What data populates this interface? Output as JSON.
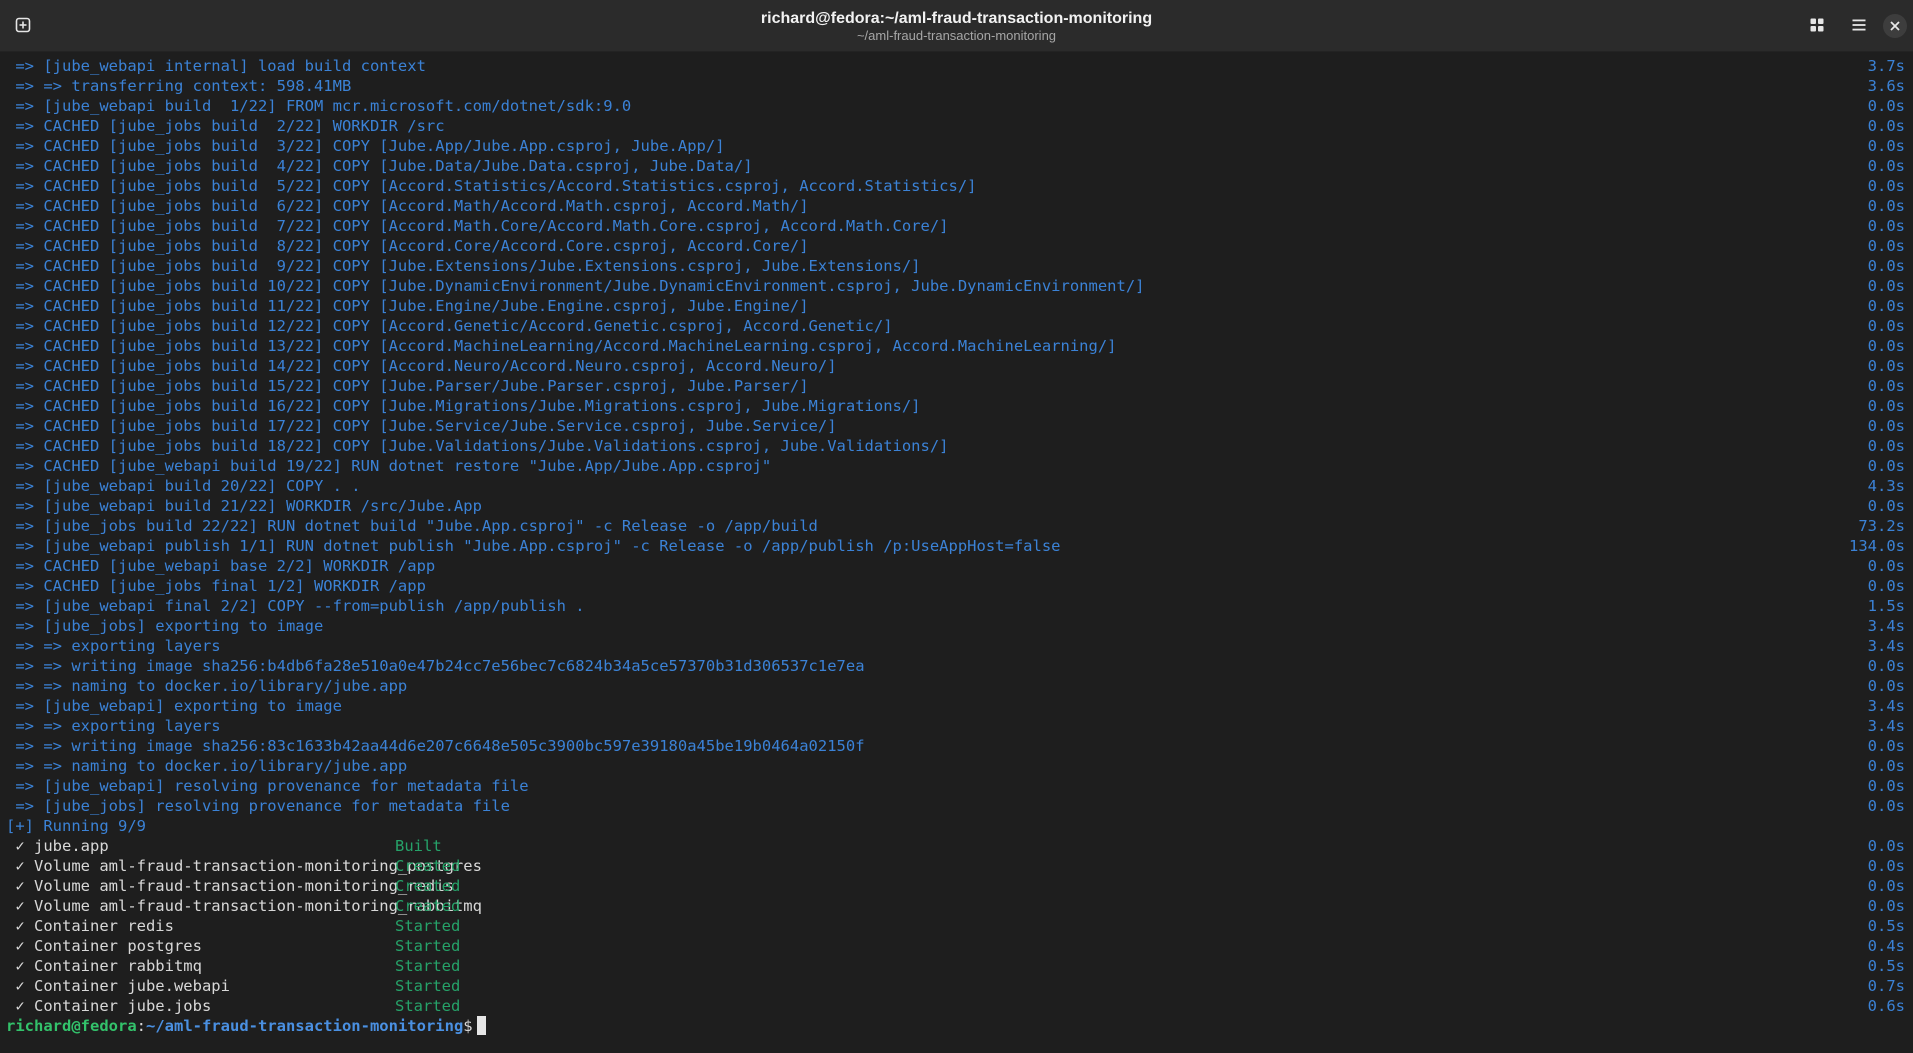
{
  "window": {
    "title": "richard@fedora:~/aml-fraud-transaction-monitoring",
    "subtitle": "~/aml-fraud-transaction-monitoring",
    "icons": {
      "new_tab": "new-tab-icon",
      "view": "grid-view-icon",
      "menu": "hamburger-menu-icon",
      "close": "close-icon"
    }
  },
  "build_log": [
    {
      "text": " => [jube_webapi internal] load build context",
      "time": "3.7s"
    },
    {
      "text": " => => transferring context: 598.41MB",
      "time": "3.6s"
    },
    {
      "text": " => [jube_webapi build  1/22] FROM mcr.microsoft.com/dotnet/sdk:9.0",
      "time": "0.0s"
    },
    {
      "text": " => CACHED [jube_jobs build  2/22] WORKDIR /src",
      "time": "0.0s"
    },
    {
      "text": " => CACHED [jube_jobs build  3/22] COPY [Jube.App/Jube.App.csproj, Jube.App/]",
      "time": "0.0s"
    },
    {
      "text": " => CACHED [jube_jobs build  4/22] COPY [Jube.Data/Jube.Data.csproj, Jube.Data/]",
      "time": "0.0s"
    },
    {
      "text": " => CACHED [jube_jobs build  5/22] COPY [Accord.Statistics/Accord.Statistics.csproj, Accord.Statistics/]",
      "time": "0.0s"
    },
    {
      "text": " => CACHED [jube_jobs build  6/22] COPY [Accord.Math/Accord.Math.csproj, Accord.Math/]",
      "time": "0.0s"
    },
    {
      "text": " => CACHED [jube_jobs build  7/22] COPY [Accord.Math.Core/Accord.Math.Core.csproj, Accord.Math.Core/]",
      "time": "0.0s"
    },
    {
      "text": " => CACHED [jube_jobs build  8/22] COPY [Accord.Core/Accord.Core.csproj, Accord.Core/]",
      "time": "0.0s"
    },
    {
      "text": " => CACHED [jube_jobs build  9/22] COPY [Jube.Extensions/Jube.Extensions.csproj, Jube.Extensions/]",
      "time": "0.0s"
    },
    {
      "text": " => CACHED [jube_jobs build 10/22] COPY [Jube.DynamicEnvironment/Jube.DynamicEnvironment.csproj, Jube.DynamicEnvironment/]",
      "time": "0.0s"
    },
    {
      "text": " => CACHED [jube_jobs build 11/22] COPY [Jube.Engine/Jube.Engine.csproj, Jube.Engine/]",
      "time": "0.0s"
    },
    {
      "text": " => CACHED [jube_jobs build 12/22] COPY [Accord.Genetic/Accord.Genetic.csproj, Accord.Genetic/]",
      "time": "0.0s"
    },
    {
      "text": " => CACHED [jube_jobs build 13/22] COPY [Accord.MachineLearning/Accord.MachineLearning.csproj, Accord.MachineLearning/]",
      "time": "0.0s"
    },
    {
      "text": " => CACHED [jube_jobs build 14/22] COPY [Accord.Neuro/Accord.Neuro.csproj, Accord.Neuro/]",
      "time": "0.0s"
    },
    {
      "text": " => CACHED [jube_jobs build 15/22] COPY [Jube.Parser/Jube.Parser.csproj, Jube.Parser/]",
      "time": "0.0s"
    },
    {
      "text": " => CACHED [jube_jobs build 16/22] COPY [Jube.Migrations/Jube.Migrations.csproj, Jube.Migrations/]",
      "time": "0.0s"
    },
    {
      "text": " => CACHED [jube_jobs build 17/22] COPY [Jube.Service/Jube.Service.csproj, Jube.Service/]",
      "time": "0.0s"
    },
    {
      "text": " => CACHED [jube_jobs build 18/22] COPY [Jube.Validations/Jube.Validations.csproj, Jube.Validations/]",
      "time": "0.0s"
    },
    {
      "text": " => CACHED [jube_webapi build 19/22] RUN dotnet restore \"Jube.App/Jube.App.csproj\"",
      "time": "0.0s"
    },
    {
      "text": " => [jube_webapi build 20/22] COPY . .",
      "time": "4.3s"
    },
    {
      "text": " => [jube_webapi build 21/22] WORKDIR /src/Jube.App",
      "time": "0.0s"
    },
    {
      "text": " => [jube_jobs build 22/22] RUN dotnet build \"Jube.App.csproj\" -c Release -o /app/build",
      "time": "73.2s"
    },
    {
      "text": " => [jube_webapi publish 1/1] RUN dotnet publish \"Jube.App.csproj\" -c Release -o /app/publish /p:UseAppHost=false",
      "time": "134.0s"
    },
    {
      "text": " => CACHED [jube_webapi base 2/2] WORKDIR /app",
      "time": "0.0s"
    },
    {
      "text": " => CACHED [jube_jobs final 1/2] WORKDIR /app",
      "time": "0.0s"
    },
    {
      "text": " => [jube_webapi final 2/2] COPY --from=publish /app/publish .",
      "time": "1.5s"
    },
    {
      "text": " => [jube_jobs] exporting to image",
      "time": "3.4s"
    },
    {
      "text": " => => exporting layers",
      "time": "3.4s"
    },
    {
      "text": " => => writing image sha256:b4db6fa28e510a0e47b24cc7e56bec7c6824b34a5ce57370b31d306537c1e7ea",
      "time": "0.0s"
    },
    {
      "text": " => => naming to docker.io/library/jube.app",
      "time": "0.0s"
    },
    {
      "text": " => [jube_webapi] exporting to image",
      "time": "3.4s"
    },
    {
      "text": " => => exporting layers",
      "time": "3.4s"
    },
    {
      "text": " => => writing image sha256:83c1633b42aa44d6e207c6648e505c3900bc597e39180a45be19b0464a02150f",
      "time": "0.0s"
    },
    {
      "text": " => => naming to docker.io/library/jube.app",
      "time": "0.0s"
    },
    {
      "text": " => [jube_webapi] resolving provenance for metadata file",
      "time": "0.0s"
    },
    {
      "text": " => [jube_jobs] resolving provenance for metadata file",
      "time": "0.0s"
    }
  ],
  "running_header": "[+] Running 9/9",
  "resources": [
    {
      "name": " ✓ jube.app",
      "status": "Built",
      "time": "0.0s"
    },
    {
      "name": " ✓ Volume aml-fraud-transaction-monitoring_postgres",
      "status": "Created",
      "time": "0.0s"
    },
    {
      "name": " ✓ Volume aml-fraud-transaction-monitoring_redis",
      "status": "Created",
      "time": "0.0s"
    },
    {
      "name": " ✓ Volume aml-fraud-transaction-monitoring_rabbitmq",
      "status": "Created",
      "time": "0.0s"
    },
    {
      "name": " ✓ Container redis",
      "status": "Started",
      "time": "0.5s"
    },
    {
      "name": " ✓ Container postgres",
      "status": "Started",
      "time": "0.4s"
    },
    {
      "name": " ✓ Container rabbitmq",
      "status": "Started",
      "time": "0.5s"
    },
    {
      "name": " ✓ Container jube.webapi",
      "status": "Started",
      "time": "0.7s"
    },
    {
      "name": " ✓ Container jube.jobs",
      "status": "Started",
      "time": "0.6s"
    }
  ],
  "prompt": {
    "user_host": "richard@fedora",
    "sep": ":",
    "path": "~/aml-fraud-transaction-monitoring",
    "symbol": "$"
  },
  "colors": {
    "background": "#1e1e1e",
    "log_blue": "#3b82d6",
    "status_green": "#26a269",
    "prompt_green": "#33c26b"
  }
}
